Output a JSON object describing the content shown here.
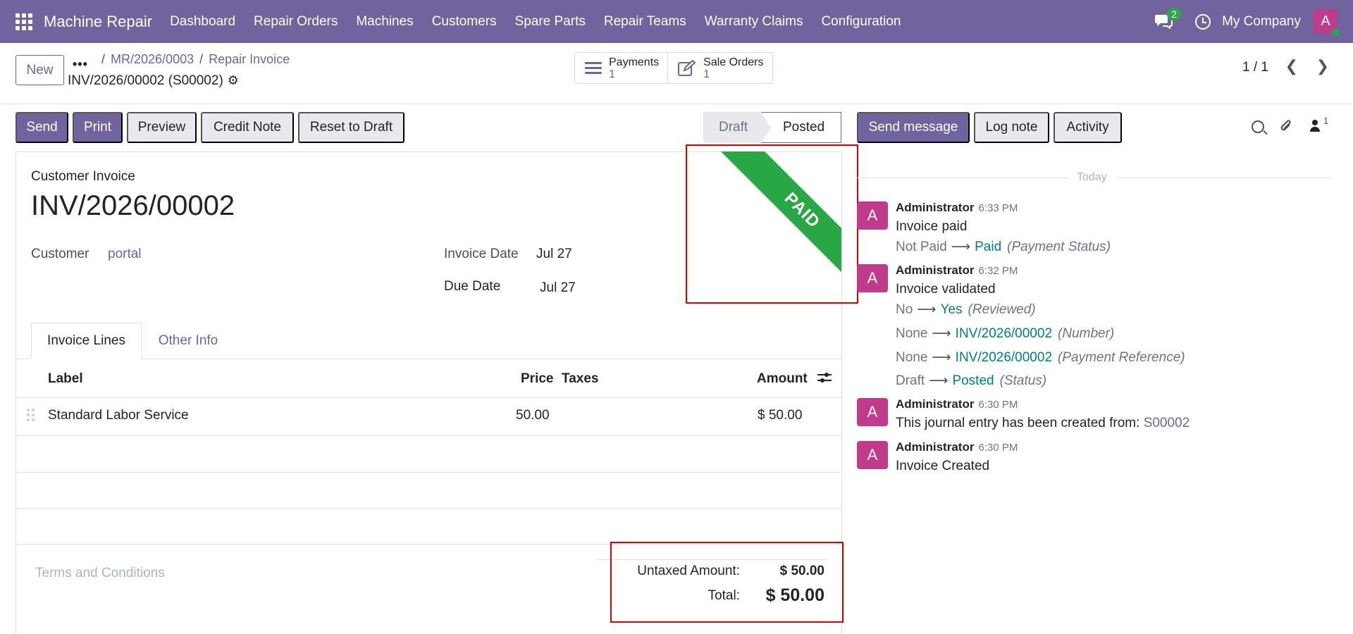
{
  "navbar": {
    "app_name": "Machine Repair",
    "menu": [
      "Dashboard",
      "Repair Orders",
      "Machines",
      "Customers",
      "Spare Parts",
      "Repair Teams",
      "Warranty Claims",
      "Configuration"
    ],
    "chat_count": "2",
    "company": "My Company",
    "user_initial": "A"
  },
  "control": {
    "new_label": "New",
    "breadcrumb": [
      "MR/2026/0003",
      "Repair Invoice"
    ],
    "record_title": "INV/2026/00002 (S00002)",
    "smart_buttons": [
      {
        "label": "Payments",
        "count": "1",
        "icon": "list-icon"
      },
      {
        "label": "Sale Orders",
        "count": "1",
        "icon": "edit-icon"
      }
    ],
    "pager": "1 / 1"
  },
  "actions": {
    "send": "Send",
    "print": "Print",
    "preview": "Preview",
    "credit_note": "Credit Note",
    "reset": "Reset to Draft"
  },
  "status": {
    "draft": "Draft",
    "posted": "Posted"
  },
  "invoice": {
    "type": "Customer Invoice",
    "name": "INV/2026/00002",
    "customer_label": "Customer",
    "customer": "portal",
    "invoice_date_label": "Invoice Date",
    "invoice_date": "Jul 27",
    "due_date_label": "Due Date",
    "due_date": "Jul 27",
    "ribbon": "PAID"
  },
  "tabs": {
    "lines": "Invoice Lines",
    "other": "Other Info"
  },
  "lines": {
    "headers": {
      "label": "Label",
      "price": "Price",
      "taxes": "Taxes",
      "amount": "Amount"
    },
    "rows": [
      {
        "label": "Standard Labor Service",
        "price": "50.00",
        "taxes": "",
        "amount": "$ 50.00"
      }
    ]
  },
  "totals": {
    "terms_placeholder": "Terms and Conditions",
    "untaxed_label": "Untaxed Amount:",
    "untaxed_value": "$ 50.00",
    "total_label": "Total:",
    "total_value": "$ 50.00"
  },
  "chatter": {
    "send_message": "Send message",
    "log_note": "Log note",
    "activity": "Activity",
    "followers_count": "1",
    "today": "Today",
    "messages": [
      {
        "author": "Administrator",
        "time": "6:33 PM",
        "body": "Invoice paid",
        "tracking": [
          {
            "old": "Not Paid",
            "new": "Paid",
            "field": "(Payment Status)"
          }
        ]
      },
      {
        "author": "Administrator",
        "time": "6:32 PM",
        "body": "Invoice validated",
        "tracking": [
          {
            "old": "No",
            "new": "Yes",
            "field": "(Reviewed)"
          },
          {
            "old": "None",
            "new": "INV/2026/00002",
            "field": "(Number)"
          },
          {
            "old": "None",
            "new": "INV/2026/00002",
            "field": "(Payment Reference)"
          },
          {
            "old": "Draft",
            "new": "Posted",
            "field": "(Status)"
          }
        ]
      },
      {
        "author": "Administrator",
        "time": "6:30 PM",
        "body": "This journal entry has been created from:",
        "link": "S00002"
      },
      {
        "author": "Administrator",
        "time": "6:30 PM",
        "body": "Invoice Created"
      }
    ]
  },
  "colors": {
    "brand": "#71639e",
    "paid_ribbon": "#28a745",
    "avatar": "#c03b8b",
    "highlight": "#e00000"
  }
}
